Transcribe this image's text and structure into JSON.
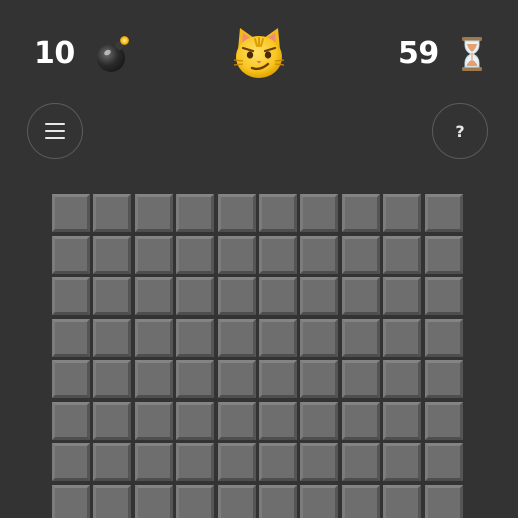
{
  "header": {
    "mines_remaining": "10",
    "mine_icon": "bomb-icon",
    "face_icon": "smirking-cat-icon",
    "timer": "59",
    "timer_icon": "hourglass-icon"
  },
  "controls": {
    "menu_icon": "hamburger-menu-icon",
    "help_label": "?"
  },
  "board": {
    "columns": 10,
    "visible_rows": 8,
    "cell_state": "unrevealed"
  },
  "colors": {
    "background": "#333333",
    "cell": "#6e6e6e",
    "text": "#ffffff"
  }
}
